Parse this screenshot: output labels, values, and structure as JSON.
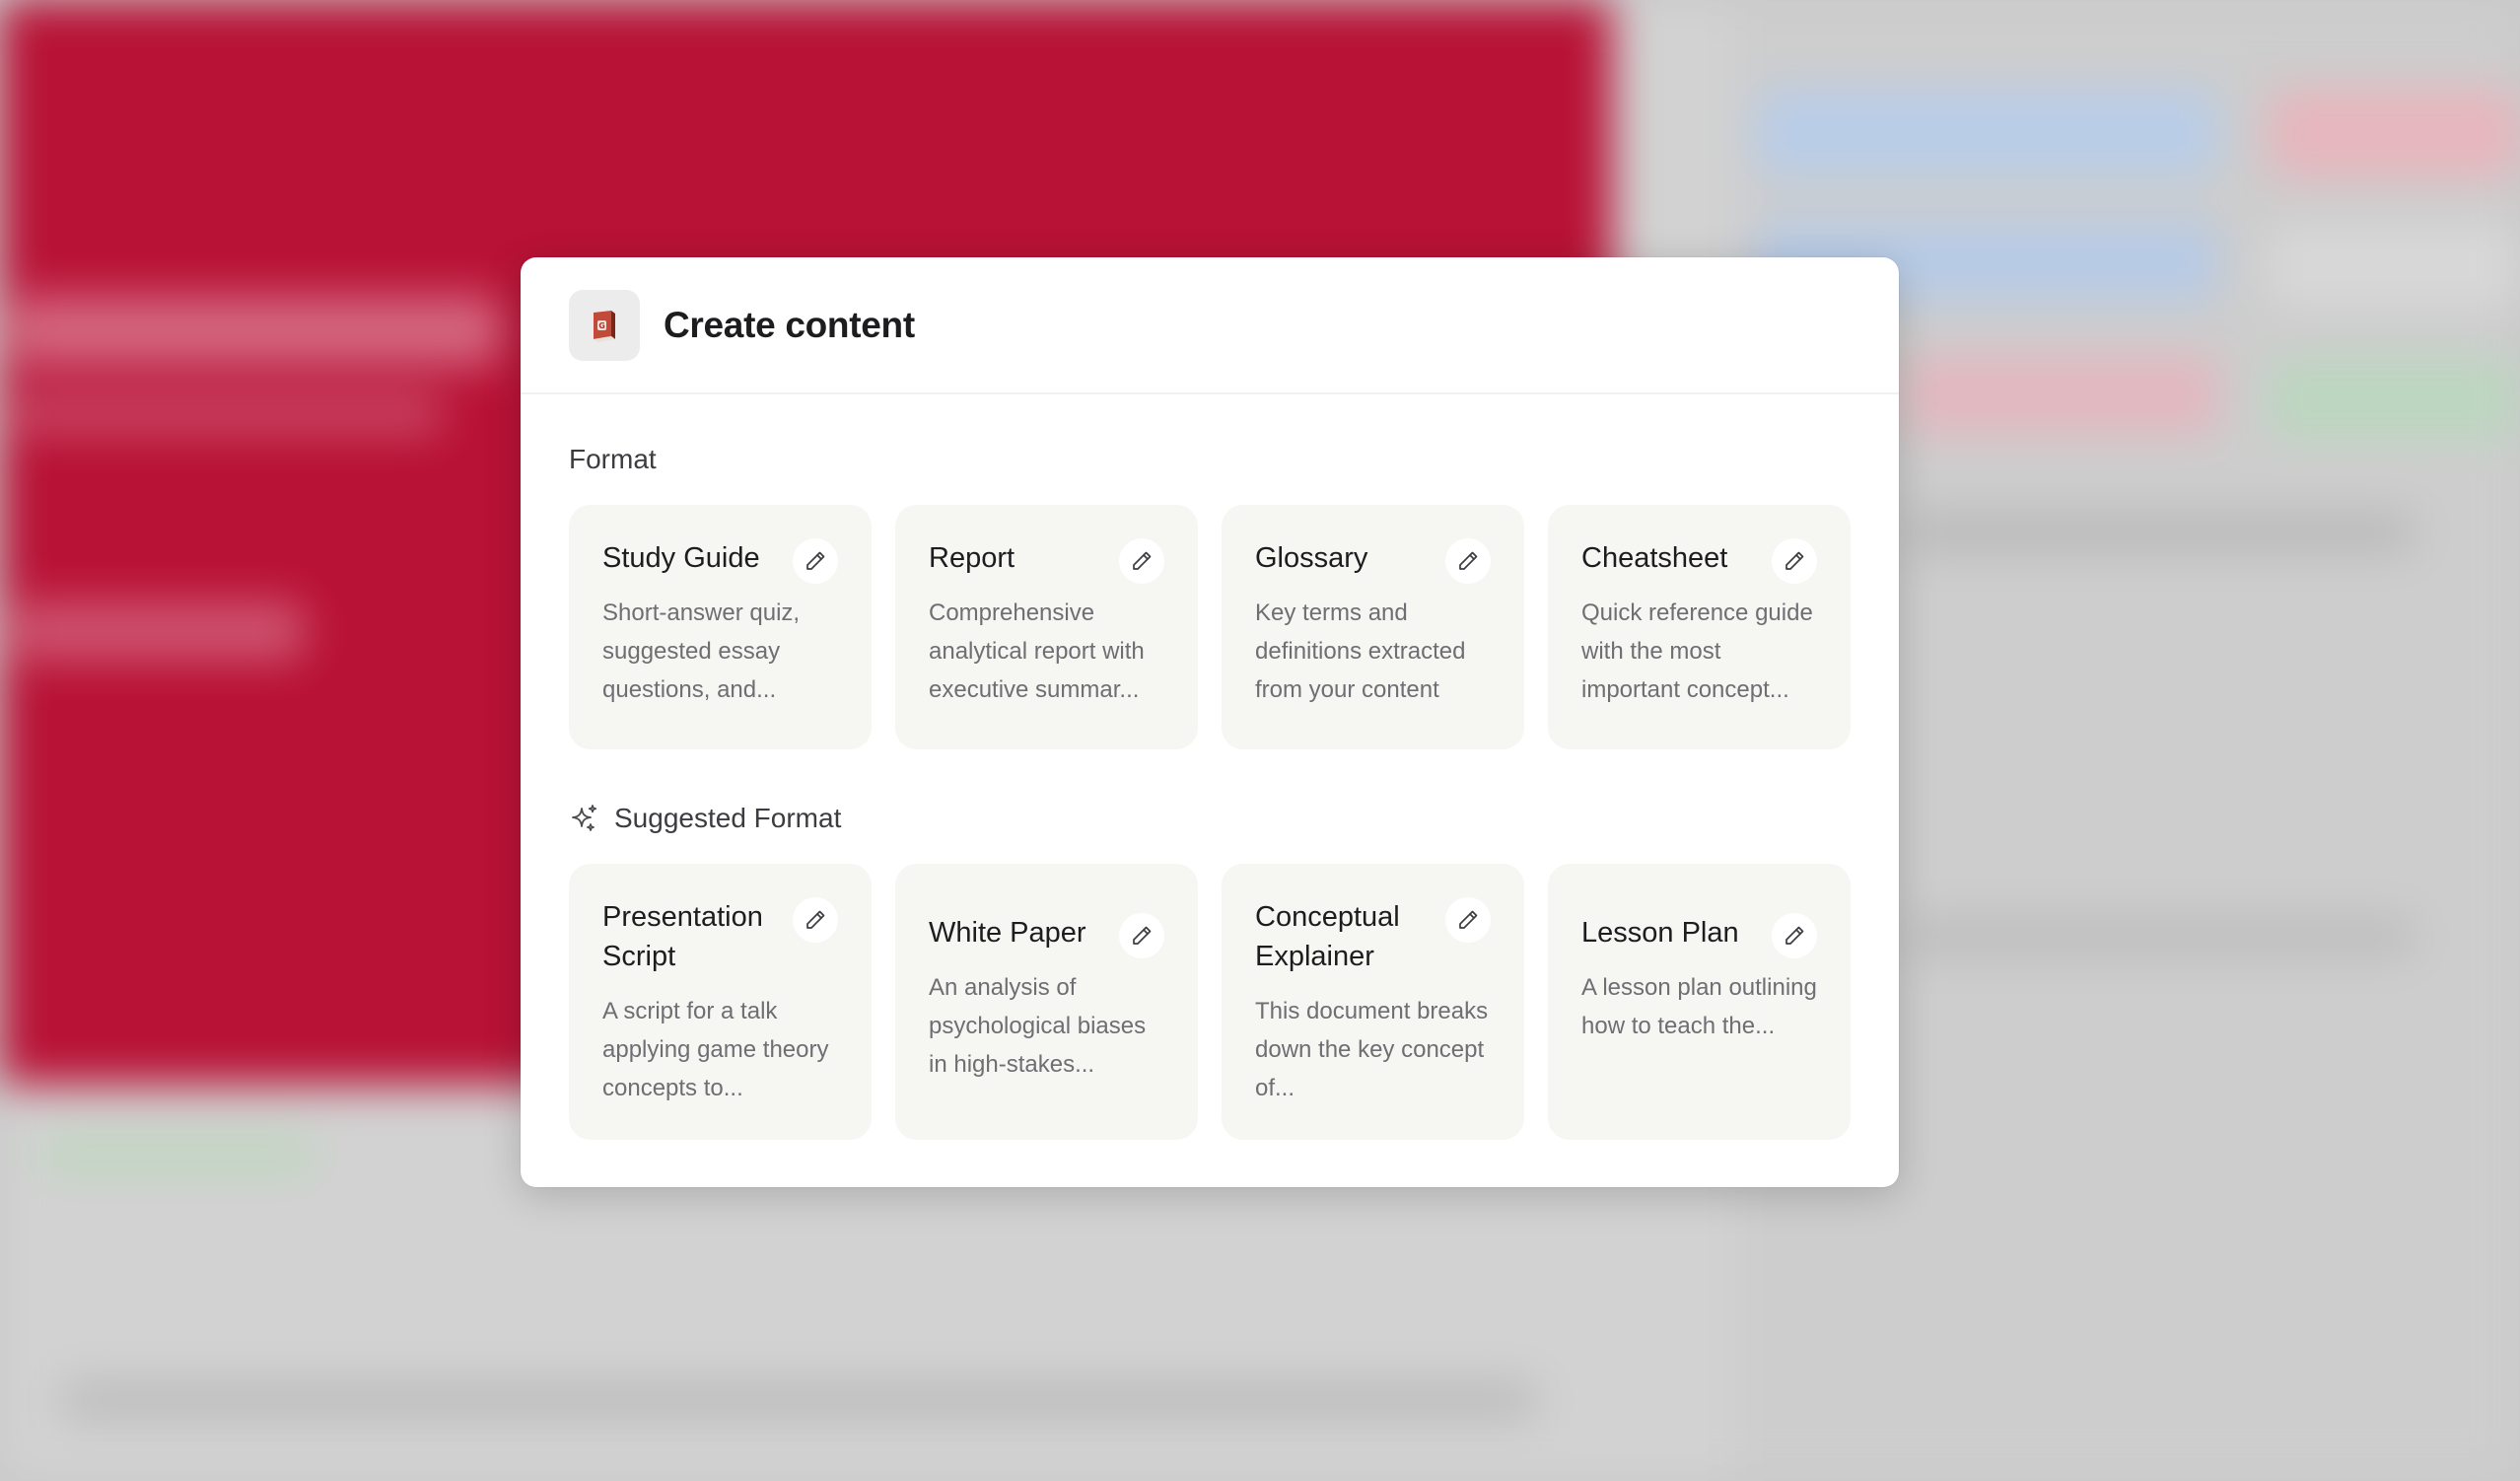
{
  "modal": {
    "title": "Create content",
    "app_icon": "book-icon",
    "format_label": "Format",
    "suggested_label": "Suggested Format",
    "formats": [
      {
        "title": "Study Guide",
        "description": "Short-answer quiz, suggested essay questions, and..."
      },
      {
        "title": "Report",
        "description": "Comprehensive analytical report with executive summar..."
      },
      {
        "title": "Glossary",
        "description": "Key terms and definitions extracted from your content"
      },
      {
        "title": "Cheatsheet",
        "description": "Quick reference guide with the most important concept..."
      }
    ],
    "suggested": [
      {
        "title": "Presentation Script",
        "description": "A script for a talk applying game theory concepts to..."
      },
      {
        "title": "White Paper",
        "description": "An analysis of psychological biases in high-stakes..."
      },
      {
        "title": "Conceptual Explainer",
        "description": "This document breaks down the key concept of..."
      },
      {
        "title": "Lesson Plan",
        "description": "A lesson plan outlining how to teach the..."
      }
    ]
  },
  "colors": {
    "hero_red": "#b81236",
    "modal_bg": "#ffffff",
    "card_bg": "#f6f6f3",
    "icon_book": "#a8362a"
  }
}
